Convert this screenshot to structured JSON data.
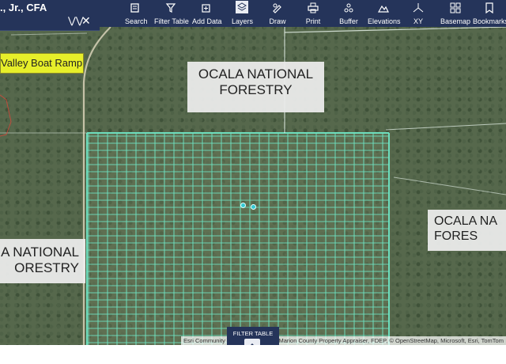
{
  "panel": {
    "title": "., Jr., CFA",
    "collapse_icon": "double-chevron-down-icon",
    "close_icon": "close-icon"
  },
  "toolbar": {
    "items": [
      {
        "label": "Search",
        "icon": "search-icon"
      },
      {
        "label": "Filter Table",
        "icon": "filter-icon"
      },
      {
        "label": "Add Data",
        "icon": "add-data-icon"
      },
      {
        "label": "Layers",
        "icon": "layers-icon",
        "active": true
      },
      {
        "label": "Draw",
        "icon": "draw-icon"
      },
      {
        "label": "Print",
        "icon": "print-icon"
      },
      {
        "label": "Buffer",
        "icon": "buffer-icon"
      },
      {
        "label": "Elevations",
        "icon": "elevations-icon"
      },
      {
        "label": "XY",
        "icon": "xy-icon"
      },
      {
        "label": "Basemap",
        "icon": "basemap-icon"
      },
      {
        "label": "Bookmarks",
        "icon": "bookmarks-icon"
      }
    ]
  },
  "map": {
    "labels": {
      "forest_top_line1": "OCALA NATIONAL",
      "forest_top_line2": "FORESTRY",
      "forest_right_line1": "OCALA NA",
      "forest_right_line2": "FORES",
      "forest_left_line1": "A NATIONAL",
      "forest_left_line2": "ORESTRY",
      "boat_ramp": "Valley Boat Ramp"
    },
    "attribution": "Esri Community Maps Contributors, Marion County Property Appraiser, FDEP, © OpenStreetMap, Microsoft, Esri, TomTom",
    "parcel_color": "#6fe3c2",
    "boundary_color": "#e8f4ec"
  },
  "filter_table": {
    "label": "FILTER TABLE",
    "chevron_icon": "chevron-up-icon"
  },
  "colors": {
    "toolbar_bg": "#25345a",
    "boat_ramp_bg": "#e7ef2a"
  }
}
